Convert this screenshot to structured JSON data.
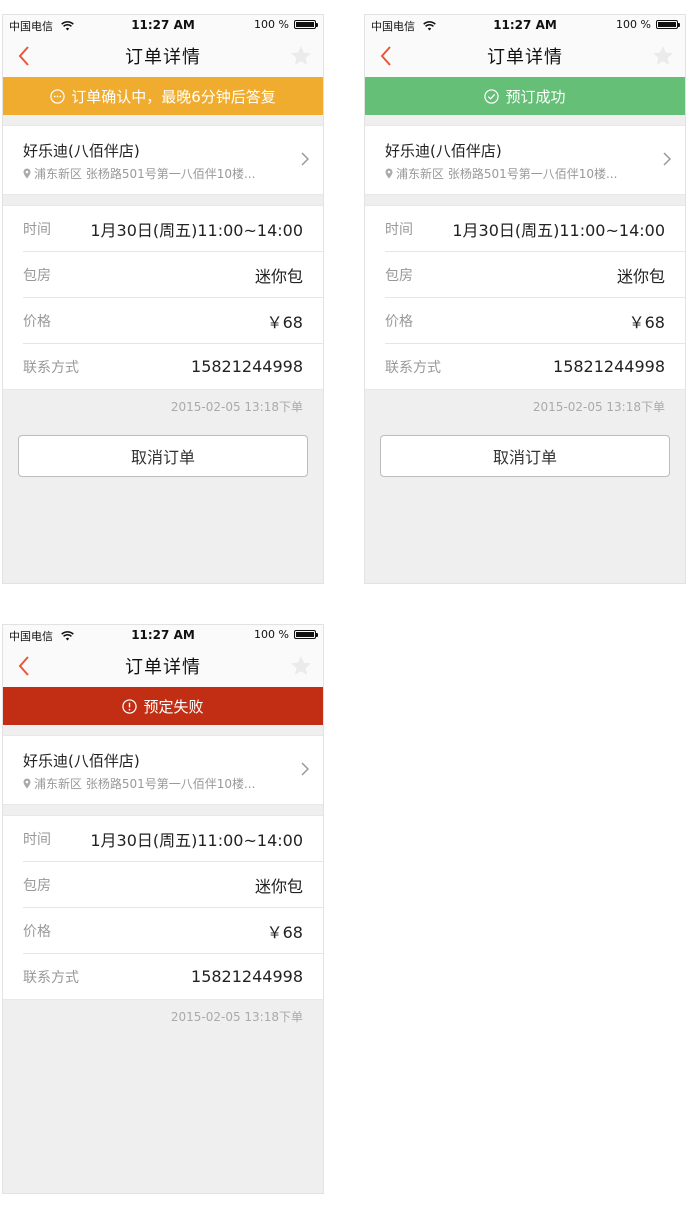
{
  "status_bar": {
    "carrier": "中国电信",
    "time": "11:27 AM",
    "battery": "100 %",
    "battery_level": 1.0
  },
  "nav": {
    "title": "订单详情",
    "back_icon": "chevron-left-icon",
    "star_icon": "star-icon"
  },
  "colors": {
    "accent": "#e8583a",
    "pending": "#efac2f",
    "success": "#65bf77",
    "failed": "#c22e13"
  },
  "screens": [
    {
      "id": "pending",
      "banner": {
        "text": "订单确认中，最晚6分钟后答复",
        "icon": "ellipsis-circle-icon"
      },
      "shop": {
        "name": "好乐迪(八佰伴店)",
        "address": "浦东新区 张杨路501号第一八佰伴10楼..."
      },
      "info": [
        {
          "label": "时间",
          "value": "1月30日(周五)11:00~14:00"
        },
        {
          "label": "包房",
          "value": "迷你包"
        },
        {
          "label": "价格",
          "value": "￥68"
        },
        {
          "label": "联系方式",
          "value": "15821244998"
        }
      ],
      "timestamp": "2015-02-05 13:18下单",
      "cancel_label": "取消订单"
    },
    {
      "id": "success",
      "banner": {
        "text": "预订成功",
        "icon": "check-circle-icon"
      },
      "shop": {
        "name": "好乐迪(八佰伴店)",
        "address": "浦东新区 张杨路501号第一八佰伴10楼..."
      },
      "info": [
        {
          "label": "时间",
          "value": "1月30日(周五)11:00~14:00"
        },
        {
          "label": "包房",
          "value": "迷你包"
        },
        {
          "label": "价格",
          "value": "￥68"
        },
        {
          "label": "联系方式",
          "value": "15821244998"
        }
      ],
      "timestamp": "2015-02-05 13:18下单",
      "cancel_label": "取消订单"
    },
    {
      "id": "failed",
      "banner": {
        "text": "预定失败",
        "icon": "exclamation-circle-icon"
      },
      "shop": {
        "name": "好乐迪(八佰伴店)",
        "address": "浦东新区 张杨路501号第一八佰伴10楼..."
      },
      "info": [
        {
          "label": "时间",
          "value": "1月30日(周五)11:00~14:00"
        },
        {
          "label": "包房",
          "value": "迷你包"
        },
        {
          "label": "价格",
          "value": "￥68"
        },
        {
          "label": "联系方式",
          "value": "15821244998"
        }
      ],
      "timestamp": "2015-02-05 13:18下单"
    }
  ]
}
